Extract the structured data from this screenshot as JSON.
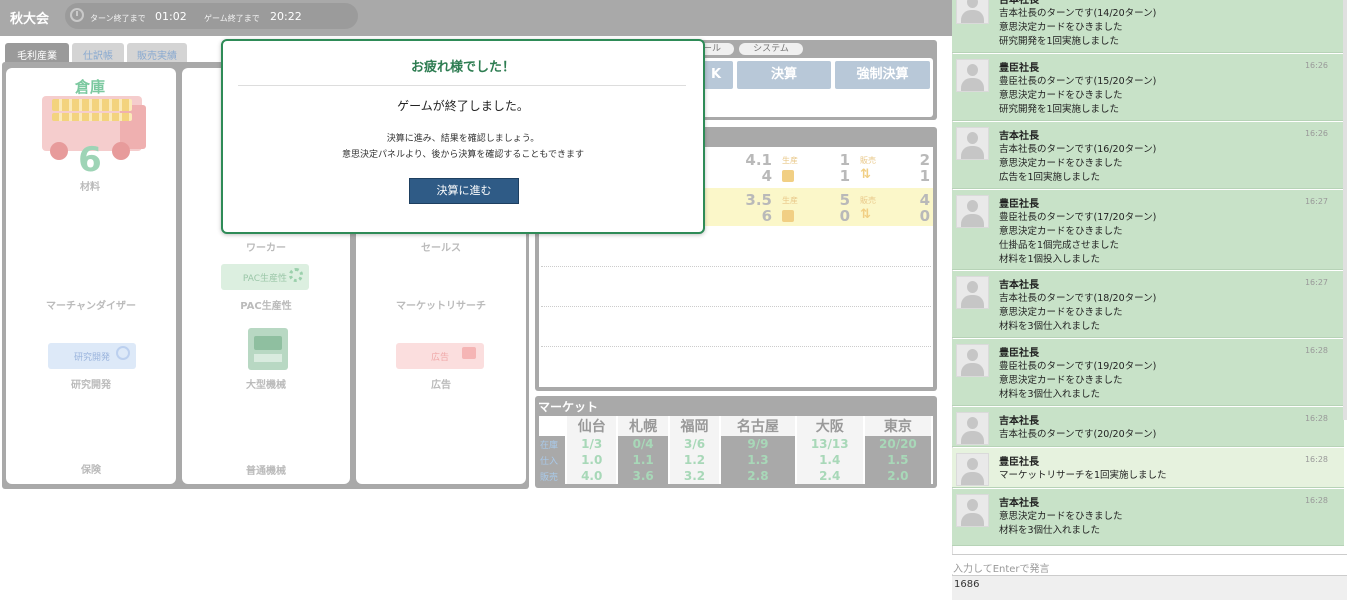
{
  "header": {
    "title": "秋大会",
    "turn_label": "ターン終了まで",
    "turn_time": "01:02",
    "game_label": "ゲーム終了まで",
    "game_time": "20:22"
  },
  "tabs": [
    "毛利産業",
    "仕訳帳",
    "販売実績"
  ],
  "board": {
    "warehouse_title": "倉庫",
    "warehouse_count": "6",
    "warehouse_unit": "材料",
    "labels": {
      "merchandiser": "マーチャンダイザー",
      "rd": "研究開発",
      "rd_chip": "研究開発",
      "insurance": "保険",
      "worker": "ワーカー",
      "pac_chip": "PAC生産性",
      "pac": "PAC生産性",
      "large_machine": "大型機械",
      "normal_machine": "普通機械",
      "sales": "セールス",
      "market_research": "マーケットリサーチ",
      "ad_chip": "広告",
      "ad": "広告"
    }
  },
  "actions": {
    "tool_label": "ール",
    "system_label": "システム",
    "hidden_label": "K",
    "settle_label": "決算",
    "force_label": "強制決算"
  },
  "players": [
    {
      "a": "4.1",
      "b": "4",
      "prod_label": "生産",
      "c": "1",
      "d": "1",
      "sell_label": "販売",
      "e": "2",
      "f": "1"
    },
    {
      "a": "3.5",
      "b": "6",
      "prod_label": "生産",
      "c": "5",
      "d": "0",
      "sell_label": "販売",
      "e": "4",
      "f": "0"
    }
  ],
  "market": {
    "title": "マーケット",
    "cities": [
      "仙台",
      "札幌",
      "福岡",
      "名古屋",
      "大阪",
      "東京"
    ],
    "rows": [
      {
        "label": "在庫",
        "values": [
          "1/3",
          "0/4",
          "3/6",
          "9/9",
          "13/13",
          "20/20"
        ]
      },
      {
        "label": "仕入",
        "values": [
          "1.0",
          "1.1",
          "1.2",
          "1.3",
          "1.4",
          "1.5"
        ]
      },
      {
        "label": "販売",
        "values": [
          "4.0",
          "3.6",
          "3.2",
          "2.8",
          "2.4",
          "2.0"
        ]
      }
    ]
  },
  "modal": {
    "title": "お疲れ様でした！",
    "message": "ゲームが終了しました。",
    "line1": "決算に進み、結果を確認しましょう。",
    "line2": "意思決定パネルより、後から決算を確認することもできます",
    "button": "決算に進む"
  },
  "chat": {
    "messages": [
      {
        "name": "吉本社長",
        "time": "",
        "lines": [
          "吉本社長のターンです(14/20ターン)",
          "意思決定カードをひきました",
          "研究開発を1回実施しました"
        ]
      },
      {
        "name": "豊臣社長",
        "time": "16:26",
        "lines": [
          "豊臣社長のターンです(15/20ターン)",
          "意思決定カードをひきました",
          "研究開発を1回実施しました"
        ]
      },
      {
        "name": "吉本社長",
        "time": "16:26",
        "lines": [
          "吉本社長のターンです(16/20ターン)",
          "意思決定カードをひきました",
          "広告を1回実施しました"
        ]
      },
      {
        "name": "豊臣社長",
        "time": "16:27",
        "lines": [
          "豊臣社長のターンです(17/20ターン)",
          "意思決定カードをひきました",
          "仕掛品を1個完成させました",
          "材料を1個投入しました"
        ]
      },
      {
        "name": "吉本社長",
        "time": "16:27",
        "lines": [
          "吉本社長のターンです(18/20ターン)",
          "意思決定カードをひきました",
          "材料を3個仕入れました"
        ]
      },
      {
        "name": "豊臣社長",
        "time": "16:28",
        "lines": [
          "豊臣社長のターンです(19/20ターン)",
          "意思決定カードをひきました",
          "材料を3個仕入れました"
        ]
      },
      {
        "name": "吉本社長",
        "time": "16:28",
        "lines": [
          "吉本社長のターンです(20/20ターン)"
        ]
      },
      {
        "name": "豊臣社長",
        "time": "16:28",
        "lines": [
          "マーケットリサーチを1回実施しました"
        ]
      },
      {
        "name": "吉本社長",
        "time": "16:28",
        "lines": [
          "意思決定カードをひきました",
          "材料を3個仕入れました"
        ]
      }
    ],
    "input_placeholder": "入力してEnterで発言",
    "footer_value": "1686"
  }
}
